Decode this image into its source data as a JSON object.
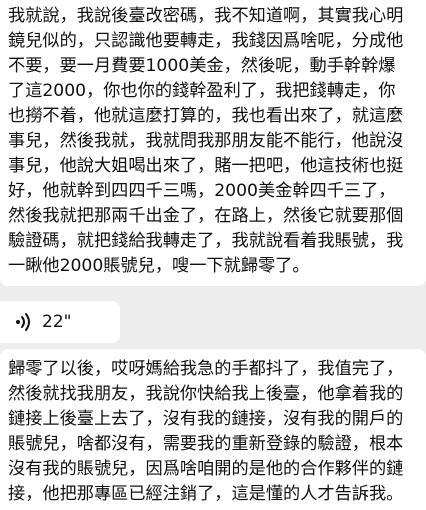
{
  "messages": [
    {
      "type": "text",
      "lines": [
        "我就說，我說後臺改密碼，我不知道啊，其實我心明",
        "鏡兒似的，只認識他要轉走，我錢因爲啥呢，分成他",
        "不要，要一月費要1000美金，然後呢，動手幹幹爆",
        "了這2000，你也你的錢幹盈利了，我把錢轉走，你",
        "也撈不着，他就這麼打算的，我也看出來了，就這麼",
        "事兒，然後我就，我就問我那朋友能不能行，他說沒",
        "事兒，他說大姐喝出來了，賭一把吧，他這技術也挺",
        "好，他就幹到四四千三嗎，2000美金幹四千三了，",
        "然後我就把那兩千出金了，在路上，然後它就要那個",
        "驗證碼，就把錢給我轉走了，我就說看着我賬號，我",
        "一瞅他2000賬號兒，嗖一下就歸零了。"
      ]
    },
    {
      "type": "voice",
      "icon": "voice-wave-icon",
      "duration": "22\""
    },
    {
      "type": "text",
      "lines": [
        "歸零了以後，哎呀媽給我急的手都抖了，我值完了，",
        "然後就找我朋友，我說你快給我上後臺，他拿着我的",
        "鏈接上後臺上去了，沒有我的鏈接，沒有我的開戶的",
        "賬號兒，啥都沒有，需要我的重新登錄的驗證，根本",
        "沒有我的賬號兒，因爲啥咱開的是他的合作夥伴的鏈",
        "接，他把那專區已經注銷了，這是懂的人才告訴我。"
      ]
    }
  ]
}
